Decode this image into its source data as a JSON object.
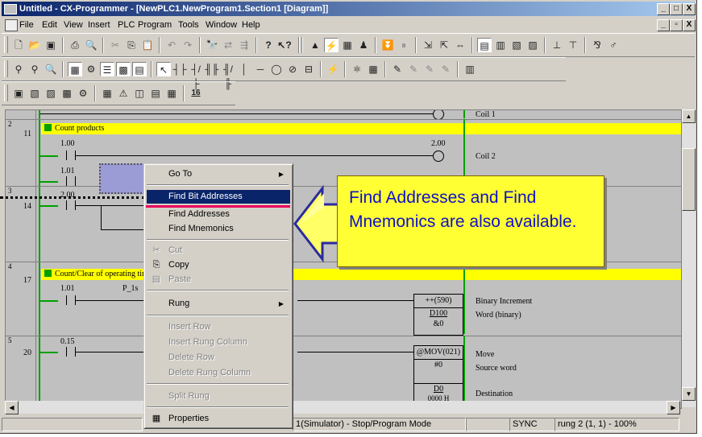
{
  "window": {
    "title": "Untitled - CX-Programmer - [NewPLC1.NewProgram1.Section1 [Diagram]]",
    "caption_buttons": [
      "_",
      "□",
      "X"
    ],
    "doc_buttons": [
      "_",
      "▫",
      "X"
    ]
  },
  "menubar": {
    "items": [
      "File",
      "Edit",
      "View",
      "Insert",
      "PLC",
      "Program",
      "Tools",
      "Window",
      "Help"
    ]
  },
  "toolbar": {
    "zoom_label": "16"
  },
  "diagram": {
    "top_coil_label": "Coil 1",
    "rungs": [
      {
        "rung_index": "2",
        "line_number": "11",
        "comment": "Count products",
        "contact1_addr": "1.00",
        "contact2_addr": "1.01",
        "coil_addr": "2.00",
        "coil_comment": "Coil 2"
      },
      {
        "rung_index": "3",
        "line_number": "14",
        "contact_addr": "2.00"
      },
      {
        "rung_index": "4",
        "line_number": "17",
        "comment": "Count/Clear of operating tim",
        "contact1_addr": "1.01",
        "contact2_addr": "P_1s",
        "instr": "++(590)",
        "op1": "D100",
        "op2": "&0",
        "instr_comment": "Binary Increment",
        "op_comment": "Word (binary)"
      },
      {
        "rung_index": "5",
        "line_number": "20",
        "contact_addr": "0.15",
        "instr": "@MOV(021)",
        "op1": "#0",
        "op2": "D0",
        "op2b": "0000 H",
        "instr_comment": "Move",
        "op1_comment": "Source word",
        "op2_comment": "Destination"
      }
    ]
  },
  "context_menu": {
    "items": [
      {
        "label": "Go To",
        "enabled": true,
        "submenu": true
      },
      {
        "label": "Find Bit Addresses",
        "enabled": true,
        "highlighted": true
      },
      {
        "label": "Find Addresses",
        "enabled": true
      },
      {
        "label": "Find Mnemonics",
        "enabled": true
      },
      {
        "label": "Cut",
        "enabled": false
      },
      {
        "label": "Copy",
        "enabled": true
      },
      {
        "label": "Paste",
        "enabled": false
      },
      {
        "label": "Rung",
        "enabled": true,
        "submenu": true
      },
      {
        "label": "Insert Row",
        "enabled": false
      },
      {
        "label": "Insert Rung Column",
        "enabled": false
      },
      {
        "label": "Delete Row",
        "enabled": false
      },
      {
        "label": "Delete Rung Column",
        "enabled": false
      },
      {
        "label": "Split Rung",
        "enabled": false
      },
      {
        "label": "Properties",
        "enabled": true
      }
    ]
  },
  "callout": {
    "text": "Find Addresses and Find Mnemonics are also available."
  },
  "statusbar": {
    "mode": "1(Simulator) - Stop/Program Mode",
    "sync": "SYNC",
    "position": "rung 2 (1, 1)  - 100%"
  },
  "colors": {
    "titlebar": "#0a246a",
    "highlight": "#0a246a",
    "comment_bar": "#ffff00",
    "ladder_green": "#00a000",
    "callout_bg": "#ffff33",
    "callout_text": "#1010c8",
    "accent_line": "#e8005a"
  }
}
